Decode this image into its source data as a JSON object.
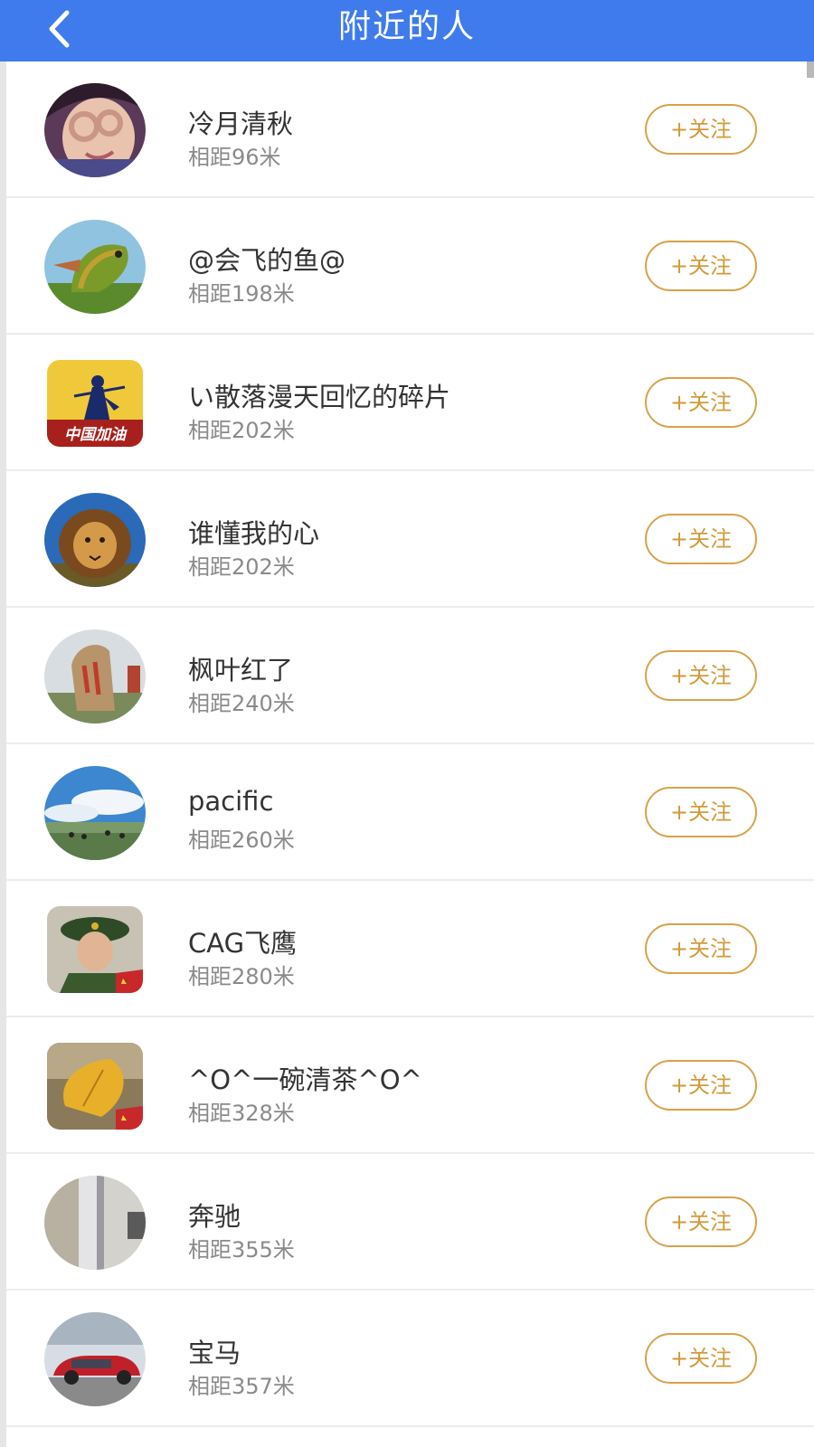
{
  "header": {
    "title": "附近的人",
    "back_icon": "chevron-left-icon",
    "background": "#3f7bec"
  },
  "accent": {
    "follow_border": "#d7a24a",
    "follow_text": "#d39a3a"
  },
  "users": [
    {
      "name": "冷月清秋",
      "distance": "相距96米",
      "follow_label": "+关注",
      "avatar": "girl-photo"
    },
    {
      "name": "@会飞的鱼@",
      "distance": "相距198米",
      "follow_label": "+关注",
      "avatar": "plant-fish-photo"
    },
    {
      "name": "い散落漫天回忆的碎片",
      "distance": "相距202米",
      "follow_label": "+关注",
      "avatar": "china-badge-image",
      "avatar_text": "中国加油"
    },
    {
      "name": "谁懂我的心",
      "distance": "相距202米",
      "follow_label": "+关注",
      "avatar": "lion-photo"
    },
    {
      "name": "枫叶红了",
      "distance": "相距240米",
      "follow_label": "+关注",
      "avatar": "stone-monument-photo"
    },
    {
      "name": "pacific",
      "distance": "相距260米",
      "follow_label": "+关注",
      "avatar": "grassland-sky-photo"
    },
    {
      "name": "CAG飞鹰",
      "distance": "相距280米",
      "follow_label": "+关注",
      "avatar": "soldier-photo"
    },
    {
      "name": "^O^一碗清茶^O^",
      "distance": "相距328米",
      "follow_label": "+关注",
      "avatar": "ginkgo-leaf-photo"
    },
    {
      "name": "奔驰",
      "distance": "相距355米",
      "follow_label": "+关注",
      "avatar": "wall-photo"
    },
    {
      "name": "宝马",
      "distance": "相距357米",
      "follow_label": "+关注",
      "avatar": "red-car-photo"
    }
  ]
}
